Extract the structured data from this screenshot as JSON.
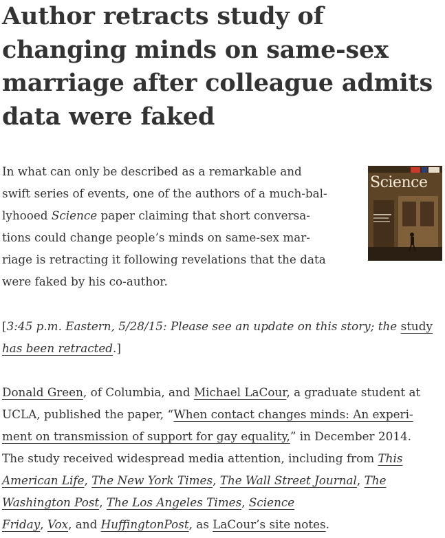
{
  "article": {
    "title_lines": [
      "Author retracts study of",
      "changing minds on same-sex",
      "marriage after colleague admits",
      "data were faked"
    ],
    "intro": {
      "l1": "In what can only be described as a remarkable and",
      "l2": "swift series of events, one of the authors of a much-bal-",
      "l3_pre": "lyhooed ",
      "l3_em": "Science",
      "l3_post": " paper claiming that short conversa-",
      "l4": "tions could change people’s minds on same-sex mar-",
      "l5": "riage is retracting it following revelations that the data",
      "l6": "were faked by his co-author."
    },
    "update": {
      "open_bracket": "[",
      "text": "3:45 p.m. Eastern, 5/28/15: Please see an update on this story; the ",
      "link_part1": "study",
      "link_part2": "has been retracted",
      "period": ".",
      "close_bracket": "]"
    },
    "body": {
      "author1": "Donald Green",
      "t1": ", of Columbia, and ",
      "author2": "Michael LaCour",
      "t2": ", a graduate student at",
      "t3": "UCLA, published the paper, “",
      "paper_link_1": "When contact changes minds: An experi-",
      "paper_link_2": "ment on transmission of support for gay equality,",
      "t4": "” in December 2014.",
      "t5": "The study received widespread media attention, including from ",
      "media1_a": "This",
      "media1_b": "American Life",
      "sep1": ", ",
      "media2": "The New York Times",
      "sep2": ", ",
      "media3": "The Wall Street Journal",
      "sep3": ", ",
      "media4_a": "The",
      "media4_b": "Washington Post",
      "sep4": ",  ",
      "media5": "The Los Angeles Times",
      "sep5": ", ",
      "media6_a": "Science",
      "media6_b": "Friday",
      "sep6": ", ",
      "media7": "Vox",
      "sep7": ", and ",
      "media8": "HuffingtonPost",
      "t6": ", as ",
      "site_link": "LaCour’s site notes",
      "t7": "."
    },
    "cover": {
      "masthead": "Science",
      "icon": "magazine-cover-image"
    }
  }
}
